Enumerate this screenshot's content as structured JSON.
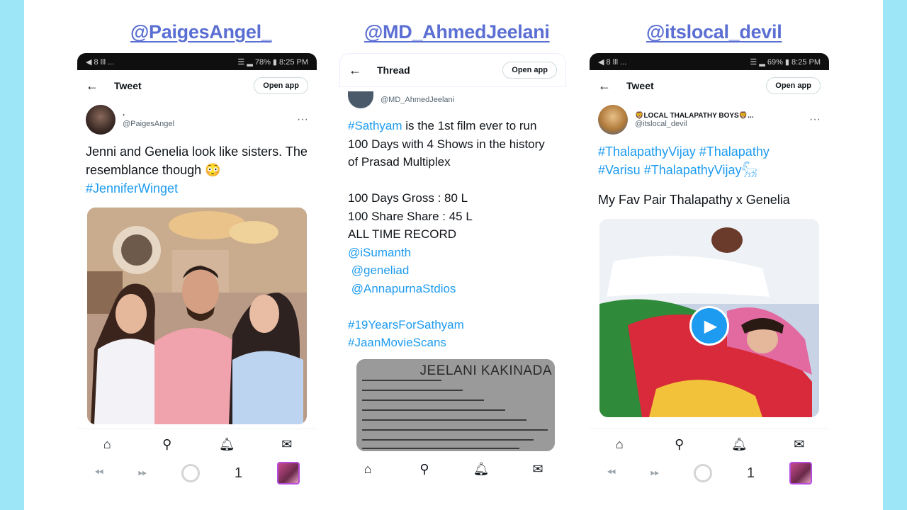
{
  "handles": [
    "@PaigesAngel_",
    "@MD_AhmedJeelani",
    "@itslocal_devil"
  ],
  "phone1": {
    "status_left": "◀ 8 lll ...",
    "status_right": "☰ ▂ 78% ▮ 8:25 PM",
    "title": "Tweet",
    "open_app": "Open app",
    "author_name": "·",
    "author_handle": "@PaigesAngel",
    "text_plain": "Jenni and Genelia look like sisters. The resemblance though 😳 ",
    "text_tag": "#JenniferWinget",
    "sys_count": "1"
  },
  "phone2": {
    "title": "Thread",
    "open_app": "Open app",
    "author_handle": "@MD_AhmedJeelani",
    "tag1": "#Sathyam",
    "text1": " is the 1st film ever to run 100 Days with 4 Shows in the history of  Prasad Multiplex",
    "line_gross": "100 Days Gross : 80 L",
    "line_share": "100 Share Share : 45 L",
    "line_record": "ALL TIME RECORD",
    "mention1": "@iSumanth",
    "mention2": "@geneliad",
    "mention3": "@AnnapurnaStdios",
    "tag2": "#19YearsForSathyam",
    "tag3": "#JaanMovieScans",
    "image_caption": "JEELANI KAKINADA"
  },
  "phone3": {
    "status_left": "◀ 8 lll ...",
    "status_right": "☰ ▂ 69% ▮ 8:25 PM",
    "title": "Tweet",
    "open_app": "Open app",
    "author_name": "🦁LOCAL THALAPATHY BOYS🦁...",
    "author_handle": "@itslocal_devil",
    "tags_line1": "#ThalapathyVijay #Thalapathy",
    "tags_line2": "#Varisu #ThalapathyVijay𓃵",
    "text": "My Fav Pair Thalapathy x Genelia",
    "sys_count": "1"
  },
  "icons": [
    "home-icon",
    "search-icon",
    "bell-icon",
    "mail-icon",
    "back-arrow-icon",
    "more-icon",
    "play-icon"
  ]
}
